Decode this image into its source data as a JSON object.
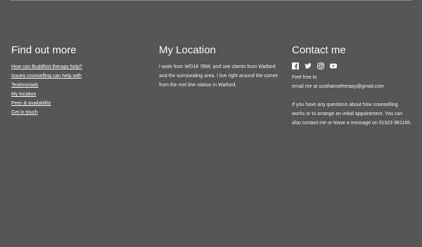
{
  "find_out_more": {
    "heading": "Find out more",
    "links": [
      "How can Buddhist therapy help?",
      "Issues counselling can help with",
      "Testimonials",
      "My location",
      "Fees & availability",
      "Get in touch"
    ]
  },
  "location": {
    "heading": "My Location",
    "text": "I work from WD18 7BW, and see clients from Watford and the surrounding area. I live right around the corner from the met line station in Watford."
  },
  "contact": {
    "heading": "Contact me",
    "social_icons": [
      "facebook-icon",
      "twitter-icon",
      "instagram-icon",
      "youtube-icon"
    ],
    "intro_line1": "Feel free to",
    "intro_line2": "email me at susthamatherapy@gmail.com",
    "questions_text": "If you have any questions about how counselling works or to arrange an initial appointment. You can also contact me or leave a message on 01923 961165."
  },
  "colors": {
    "background": "#555555",
    "text": "#ffffff"
  }
}
